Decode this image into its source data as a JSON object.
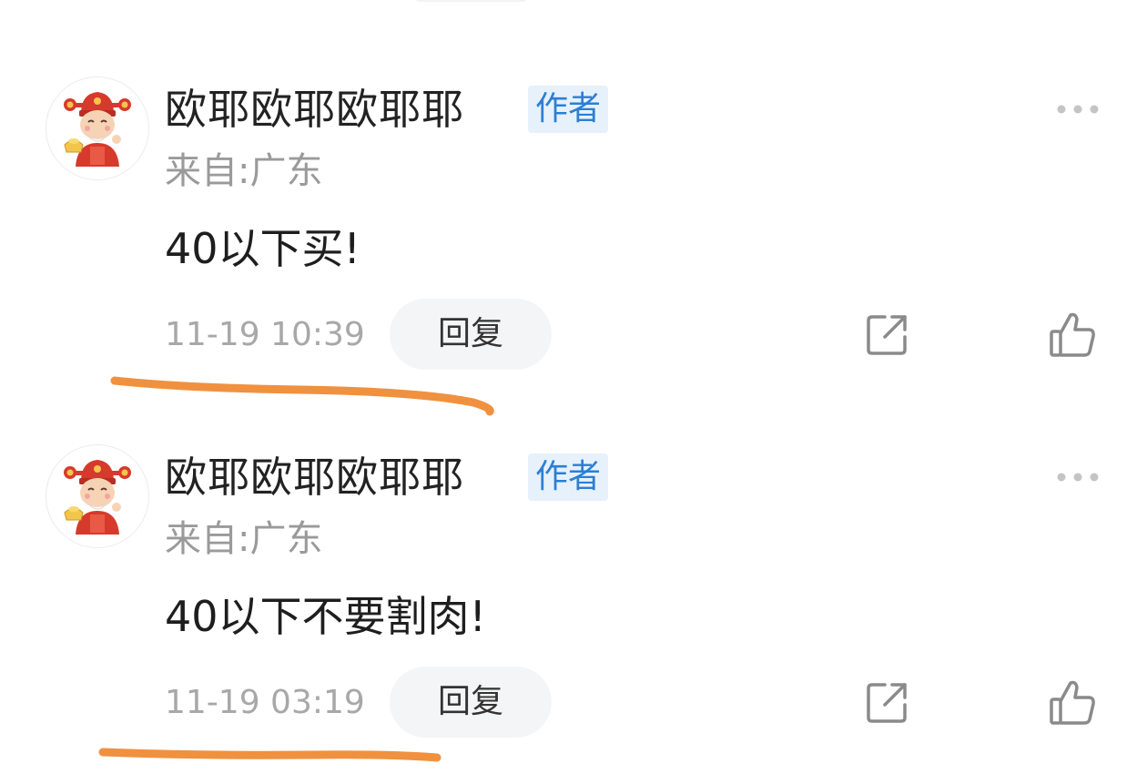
{
  "comments": [
    {
      "username": "欧耶欧耶欧耶耶",
      "badge": "作者",
      "location": "来自:广东",
      "content": "40以下买!",
      "timestamp": "11-19 10:39",
      "reply_label": "回复",
      "avatar_icon": "caishen-avatar-icon",
      "more_icon": "more-dots-icon",
      "share_icon": "share-icon",
      "like_icon": "thumbs-up-icon"
    },
    {
      "username": "欧耶欧耶欧耶耶",
      "badge": "作者",
      "location": "来自:广东",
      "content": "40以下不要割肉!",
      "timestamp": "11-19 03:19",
      "reply_label": "回复",
      "avatar_icon": "caishen-avatar-icon",
      "more_icon": "more-dots-icon",
      "share_icon": "share-icon",
      "like_icon": "thumbs-up-icon"
    }
  ],
  "colors": {
    "badge_text": "#2b7fd4",
    "badge_bg": "#e7f1fb",
    "annotation_stroke": "#f0913f",
    "meta_gray": "#9a9a9a"
  }
}
